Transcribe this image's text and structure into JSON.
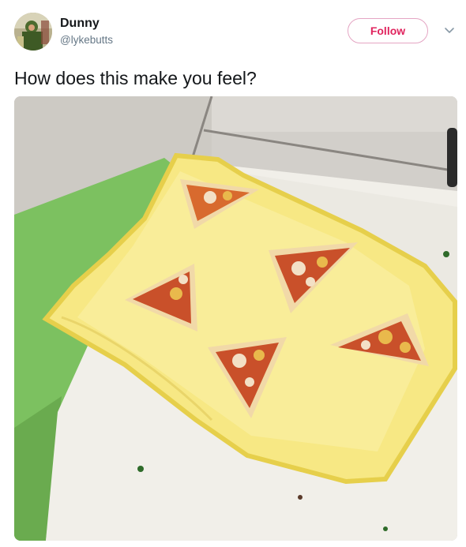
{
  "tweet": {
    "author": {
      "display_name": "Dunny",
      "handle": "@lykebutts"
    },
    "follow_label": "Follow",
    "text": "How does this make you feel?"
  },
  "icons": {
    "more": "chevron-down-icon"
  },
  "colors": {
    "follow_accent": "#e0245e",
    "handle_gray": "#657786",
    "text_dark": "#14171a"
  }
}
